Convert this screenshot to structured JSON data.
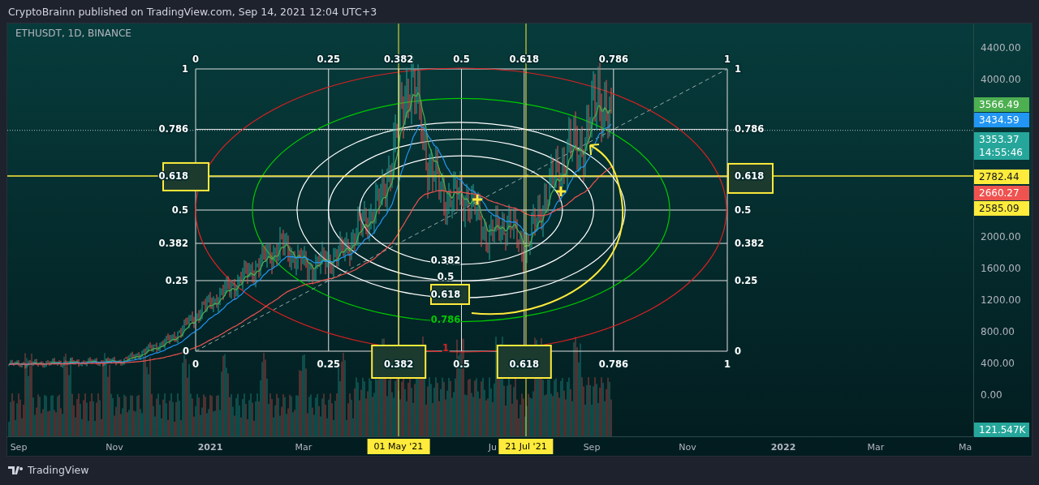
{
  "header": {
    "title": "CryptoBrainn published on TradingView.com, Sep 14, 2021 12:04 UTC+3"
  },
  "chart": {
    "symbol": "ETHUSDT, 1D, BINANCE",
    "fib_top_labels": [
      {
        "label": "0",
        "highlighted": false
      },
      {
        "label": "0.25",
        "highlighted": false
      },
      {
        "label": "0.382",
        "highlighted": false
      },
      {
        "label": "0.5",
        "highlighted": false
      },
      {
        "label": "0.618",
        "highlighted": false
      },
      {
        "label": "0.786",
        "highlighted": false
      },
      {
        "label": "1",
        "highlighted": false
      }
    ],
    "fib_bottom_labels": [
      {
        "label": "0",
        "highlighted": false
      },
      {
        "label": "0.25",
        "highlighted": false
      },
      {
        "label": "0.382",
        "highlighted": true
      },
      {
        "label": "0.5",
        "highlighted": false
      },
      {
        "label": "0.618",
        "highlighted": true
      },
      {
        "label": "0.786",
        "highlighted": false
      },
      {
        "label": "1",
        "highlighted": false
      }
    ],
    "fib_left_labels": [
      {
        "label": "1",
        "highlighted": false
      },
      {
        "label": "0.786",
        "highlighted": false
      },
      {
        "label": "0.618",
        "highlighted": true
      },
      {
        "label": "0.5",
        "highlighted": false
      },
      {
        "label": "0.382",
        "highlighted": false
      },
      {
        "label": "0.25",
        "highlighted": false
      },
      {
        "label": "0",
        "highlighted": false
      }
    ],
    "fib_right_labels": [
      {
        "label": "1",
        "highlighted": false
      },
      {
        "label": "0.786",
        "highlighted": false
      },
      {
        "label": "0.618",
        "highlighted": true
      },
      {
        "label": "0.5",
        "highlighted": false
      },
      {
        "label": "0.382",
        "highlighted": false
      },
      {
        "label": "0.25",
        "highlighted": false
      },
      {
        "label": "0",
        "highlighted": false
      }
    ],
    "ellipse_labels": [
      {
        "label": "0.382",
        "color": "#ffffff",
        "highlighted": false
      },
      {
        "label": "0.5",
        "color": "#ffffff",
        "highlighted": false
      },
      {
        "label": "0.618",
        "color": "#ffffff",
        "highlighted": true
      },
      {
        "label": "0.786",
        "color": "#00c800",
        "highlighted": false
      },
      {
        "label": "1",
        "color": "#e02020",
        "highlighted": false
      }
    ]
  },
  "price_axis": {
    "ticks": [
      "4400.00",
      "4000.00",
      "2000.00",
      "1600.00",
      "1200.00",
      "800.00",
      "400.00",
      "0.00"
    ],
    "badges": [
      {
        "value": "3566.49",
        "color": "#4caf50"
      },
      {
        "value": "3434.59",
        "color": "#2196f3"
      },
      {
        "value": "3353.37",
        "time": "14:55:46",
        "color": "#26a69a"
      },
      {
        "value": "2782.44",
        "color": "#ffeb3b"
      },
      {
        "value": "2660.27",
        "color": "#ef5350"
      },
      {
        "value": "2585.09",
        "color": "#ffeb3b"
      }
    ],
    "volume_badge": "121.547K"
  },
  "time_axis": [
    {
      "kind": "tick",
      "label": "Sep"
    },
    {
      "kind": "tick",
      "label": "Nov"
    },
    {
      "kind": "year",
      "label": "2021"
    },
    {
      "kind": "tick",
      "label": "Mar"
    },
    {
      "kind": "marker",
      "label": "01 May '21"
    },
    {
      "kind": "tick",
      "label": "Ju"
    },
    {
      "kind": "marker",
      "label": "21 Jul '21"
    },
    {
      "kind": "tick",
      "label": "Sep"
    },
    {
      "kind": "tick",
      "label": "Nov"
    },
    {
      "kind": "year",
      "label": "2022"
    },
    {
      "kind": "tick",
      "label": "Mar"
    },
    {
      "kind": "tick",
      "label": "Ma"
    }
  ],
  "footer": {
    "brand": "TradingView"
  }
}
